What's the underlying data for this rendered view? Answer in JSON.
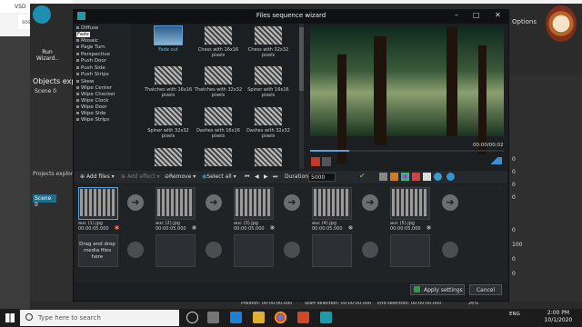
{
  "browser": {
    "tab_label": "VSD",
    "url_fragment": "sos/"
  },
  "app": {
    "run_wizard_label": "Run\nWizard..",
    "objects_title": "Objects expl",
    "scene_label": "Scene 0",
    "projects_title": "Projects explore",
    "scene_tab": "Scene 0",
    "options_label": "Options",
    "right_values": [
      "0",
      "0",
      "0",
      "0",
      "0",
      "100",
      "0",
      "0"
    ],
    "status": {
      "position": "Position:   00:00:00.000",
      "start_selection": "Start selection:   00:00:00.000",
      "end_selection": "End selection:   00:00:00.000",
      "zoom": "26%"
    }
  },
  "dialog": {
    "title": "Files sequence wizard",
    "effects": [
      "Diffuse",
      "Fade",
      "Mosaic",
      "Page Turn",
      "Perspective",
      "Push Door",
      "Push Side",
      "Push Strips",
      "Skew",
      "Wipe Center",
      "Wipe Checker",
      "Wipe Clock",
      "Wipe Door",
      "Wipe Side",
      "Wipe Strips"
    ],
    "selected_effect": "Fade",
    "thumbnails": [
      {
        "label": "Fade out",
        "selected": true
      },
      {
        "label": "Chess with 16x16 pixels",
        "selected": false
      },
      {
        "label": "Chess with 32x32 pixels",
        "selected": false
      },
      {
        "label": "Thatches with 16x16 pixels",
        "selected": false
      },
      {
        "label": "Thatches with 32x32 pixels",
        "selected": false
      },
      {
        "label": "Spiner with 16x16 pixels",
        "selected": false
      },
      {
        "label": "Spiner with 32x32 pixels",
        "selected": false
      },
      {
        "label": "Dashes with 16x16 pixels",
        "selected": false
      },
      {
        "label": "Dashes with 32x32 pixels",
        "selected": false
      }
    ],
    "preview_time": "00:00/00:02",
    "preview_progress": 0.2,
    "toolbar": {
      "add_files": "Add files",
      "add_effect": "Add effect",
      "remove": "Remove",
      "select_all": "Select all",
      "duration_label": "Duration:",
      "duration_value": "5000"
    },
    "sequence": [
      {
        "name": "auc (1).jpg",
        "time": "00:00:05.000"
      },
      {
        "name": "auc (2).jpg",
        "time": "00:00:05.000"
      },
      {
        "name": "auc (3).jpg",
        "time": "00:00:05.000"
      },
      {
        "name": "auc (4).jpg",
        "time": "00:00:05.000"
      },
      {
        "name": "auc (5).jpg",
        "time": "00:00:05.000"
      }
    ],
    "drop_text": "Drag and drop media files here",
    "apply_label": "Apply settings",
    "cancel_label": "Cancel"
  },
  "taskbar": {
    "search_placeholder": "Type here to search",
    "tray_lang": "ENG",
    "time": "2:00 PM",
    "date": "10/1/2020"
  }
}
